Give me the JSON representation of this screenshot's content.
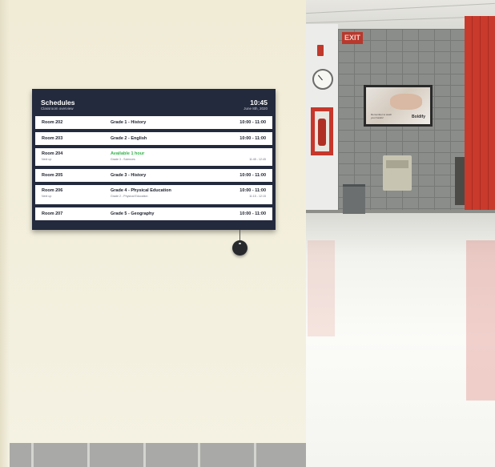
{
  "display": {
    "title": "Schedules",
    "subtitle": "Classroom overview",
    "time": "10:45",
    "date": "June 8th, 2020",
    "rows": [
      {
        "room": "Room 202",
        "course": "Grade 1 - History",
        "time": "10:00 - 11:00"
      },
      {
        "room": "Room 203",
        "course": "Grade 2 - English",
        "time": "10:00 - 11:00"
      },
      {
        "room": "Room 204",
        "next_label": "Next up",
        "course": "Available 1 hour",
        "next_course": "Grade 3 - Sciences",
        "next_time": "11:45 - 12:45"
      },
      {
        "room": "Room 205",
        "course": "Grade 3 - History",
        "time": "10:00 - 11:00"
      },
      {
        "room": "Room 206",
        "next_label": "Next up",
        "course": "Grade 4 - Physical Education",
        "next_course": "Grade 2 - Physical Education",
        "time": "10:00 - 11:00",
        "next_time": "11:15 - 12:15"
      },
      {
        "room": "Room 207",
        "course": "Grade 5 - Geography",
        "time": "10:00 - 11:00"
      }
    ]
  },
  "hallway": {
    "exit_sign": "EXIT",
    "tv_brand": "Boldify",
    "tv_caption": "Remember to wash your hands!"
  },
  "colors": {
    "display_bg": "#242a3d",
    "available_green": "#33b24a",
    "wall": "#f1ecd6",
    "locker_red": "#c93a2c"
  }
}
